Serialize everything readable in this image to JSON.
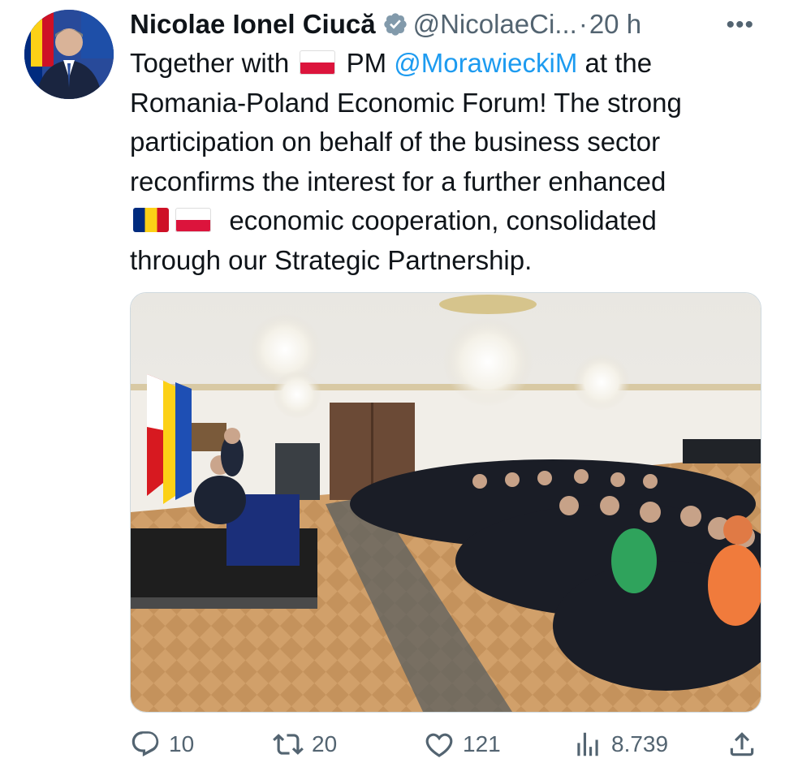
{
  "author": {
    "name": "Nicolae Ionel Ciucă",
    "handle": "@NicolaeCi...",
    "separator": "·",
    "time": "20 h"
  },
  "tweet": {
    "line1_prefix": "Together with",
    "line1_pm": "PM",
    "line1_mention": "@MorawieckiM",
    "line1_suffix": "at the",
    "line2": "Romania-Poland Economic Forum! The strong",
    "line3": "participation on behalf of the business sector",
    "line4": "reconfirms the interest for a further enhanced",
    "line5": "economic cooperation, consolidated",
    "line6": "through our Strategic Partnership."
  },
  "actions": {
    "replies": "10",
    "retweets": "20",
    "likes": "121",
    "views": "8.739"
  },
  "icons": [
    "verified-badge-icon",
    "more-options-icon",
    "reply-icon",
    "retweet-icon",
    "like-icon",
    "views-icon",
    "share-icon",
    "poland-flag-icon",
    "romania-flag-icon"
  ],
  "colors": {
    "mention": "#1d9bf0",
    "secondary_text": "#536471",
    "verified": "#829aab"
  }
}
